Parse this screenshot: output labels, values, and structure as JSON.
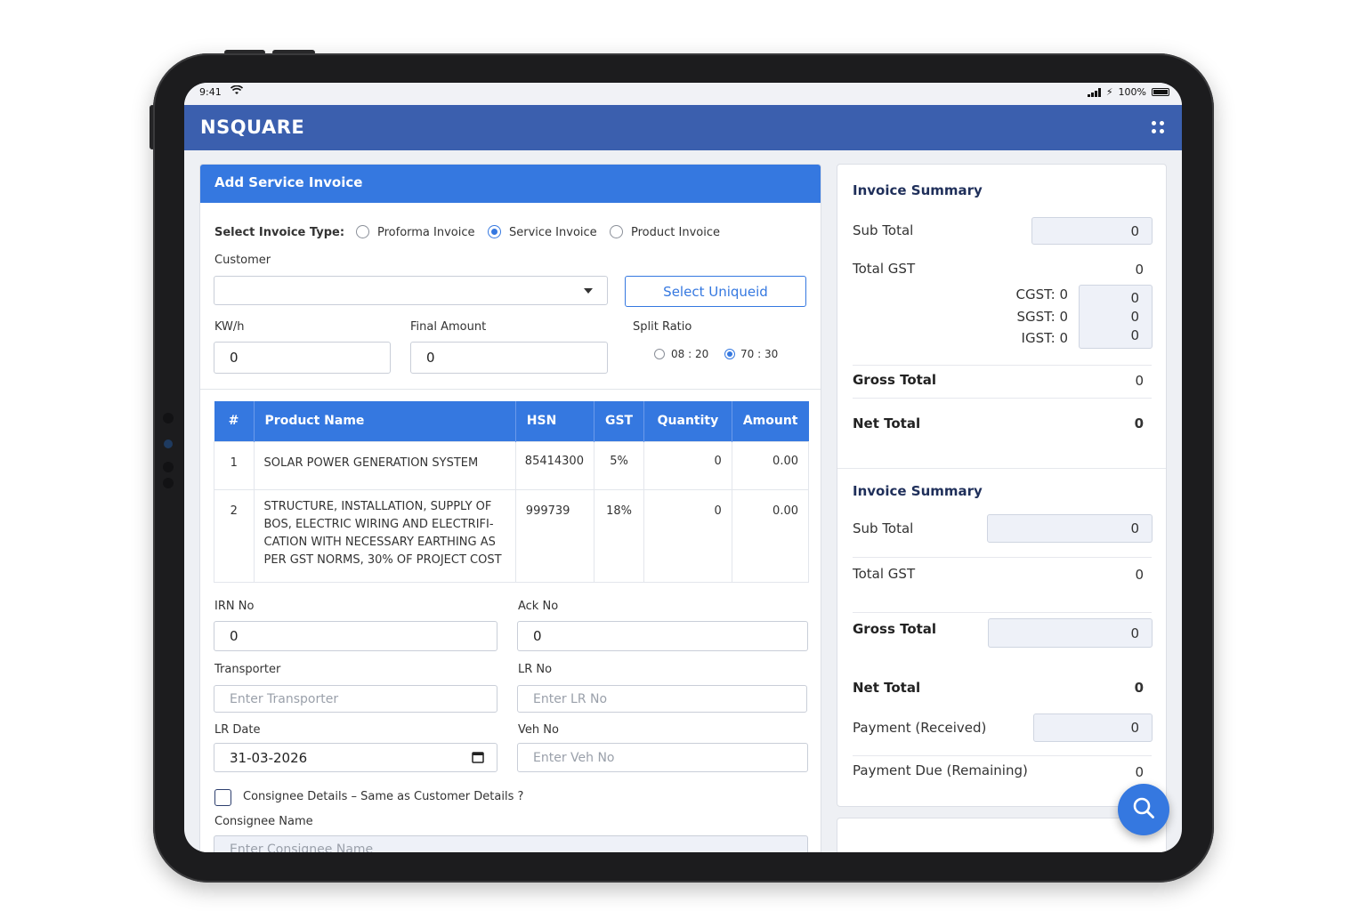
{
  "status": {
    "time": "9:41",
    "battery": "100%"
  },
  "app": {
    "brand": "NSQUARE"
  },
  "form": {
    "title": "Add Service Invoice",
    "invoice_type_label": "Select Invoice Type:",
    "invoice_types": [
      {
        "label": "Proforma Invoice",
        "selected": false
      },
      {
        "label": "Service Invoice",
        "selected": true
      },
      {
        "label": "Product Invoice",
        "selected": false
      }
    ],
    "customer_label": "Customer",
    "customer_value": "",
    "select_uniqueid_label": "Select Uniqueid",
    "kwh_label": "KW/h",
    "kwh_value": "0",
    "final_amount_label": "Final Amount",
    "final_amount_value": "0",
    "split_ratio_label": "Split Ratio",
    "split_ratio_options": [
      {
        "label": "08 : 20",
        "selected": false
      },
      {
        "label": "70 : 30",
        "selected": true
      }
    ],
    "table": {
      "headers": [
        "#",
        "Product Name",
        "HSN",
        "GST",
        "Quantity",
        "Amount"
      ],
      "rows": [
        {
          "no": "1",
          "name": "SOLAR POWER GENERATION SYSTEM",
          "hsn": "85414300",
          "gst": "5%",
          "qty": "0",
          "amount": "0.00"
        },
        {
          "no": "2",
          "name": "STRUCTURE, INSTALLATION, SUPPLY OF BOS, ELECTRIC WIRING AND ELECTRIFI-CATION WITH NECESSARY EARTHING AS PER GST NORMS, 30% OF PROJECT COST",
          "hsn": "999739",
          "gst": "18%",
          "qty": "0",
          "amount": "0.00"
        }
      ]
    },
    "irn_label": "IRN No",
    "irn_value": "0",
    "ack_label": "Ack No",
    "ack_value": "0",
    "transporter_label": "Transporter",
    "transporter_placeholder": "Enter Transporter",
    "lr_no_label": "LR No",
    "lr_no_placeholder": "Enter LR No",
    "lr_date_label": "LR Date",
    "lr_date_value": "31-03-2026",
    "veh_no_label": "Veh No",
    "veh_no_placeholder": "Enter Veh No",
    "consignee_check_label": "Consignee Details – Same as Customer Details ?",
    "consignee_name_label": "Consignee Name",
    "consignee_name_placeholder": "Enter Consignee Name"
  },
  "summary1": {
    "title": "Invoice Summary",
    "sub_total_label": "Sub Total",
    "sub_total_value": "0",
    "total_gst_label": "Total GST",
    "total_gst_value": "0",
    "cgst_label": "CGST: 0",
    "cgst_value": "0",
    "sgst_label": "SGST: 0",
    "sgst_value": "0",
    "igst_label": "IGST: 0",
    "igst_value": "0",
    "gross_total_label": "Gross Total",
    "gross_total_value": "0",
    "net_total_label": "Net Total",
    "net_total_value": "0"
  },
  "summary2": {
    "title": "Invoice Summary",
    "sub_total_label": "Sub Total",
    "sub_total_value": "0",
    "total_gst_label": "Total GST",
    "total_gst_value": "0",
    "gross_total_label": "Gross Total",
    "gross_total_value": "0",
    "net_total_label": "Net Total",
    "net_total_value": "0",
    "payment_received_label": "Payment (Received)",
    "payment_received_value": "0",
    "payment_due_label": "Payment Due (Remaining)",
    "payment_due_value": "0"
  },
  "colors": {
    "header": "#3b5fae",
    "accent": "#3578e0"
  }
}
